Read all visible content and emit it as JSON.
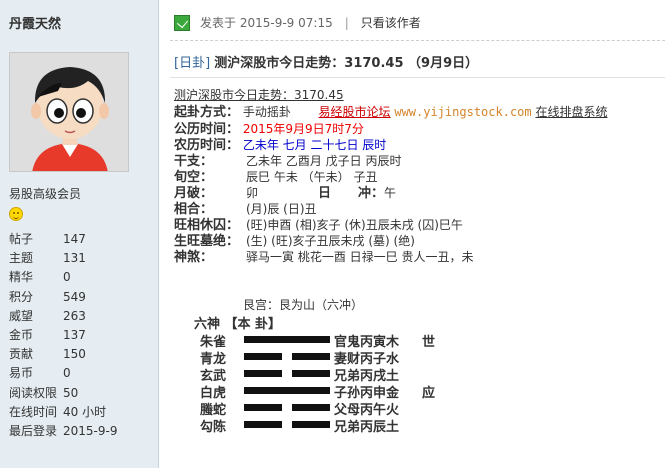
{
  "user": {
    "name": "丹霞天然",
    "group": "易股高级会员",
    "stats": [
      {
        "label": "帖子",
        "value": "147"
      },
      {
        "label": "主题",
        "value": "131"
      },
      {
        "label": "精华",
        "value": "0"
      },
      {
        "label": "积分",
        "value": "549"
      },
      {
        "label": "威望",
        "value": "263"
      },
      {
        "label": "金币",
        "value": "137"
      },
      {
        "label": "贡献",
        "value": "150"
      },
      {
        "label": "易币",
        "value": "0"
      },
      {
        "label": "阅读权限",
        "value": "50"
      },
      {
        "label": "在线时间",
        "value": "40 小时"
      },
      {
        "label": "最后登录",
        "value": "2015-9-9"
      }
    ]
  },
  "post": {
    "posted_prefix": "发表于",
    "posted_time": "2015-9-9 07:15",
    "separator": "|",
    "author_only": "只看该作者",
    "tag": "[日卦]",
    "title": "测沪深股市今日走势：3170.45 （9月9日）"
  },
  "body": {
    "first_line": "测沪深股市今日走势：3170.45",
    "method_label": "起卦方式：",
    "method_value": "手动摇卦",
    "forum_name": "易经股市论坛",
    "site_url": "www.yijingstock.com",
    "online_text": "在线排盘系统",
    "gregorian_label": "公历时间：",
    "gregorian_value": "2015年9月9日7时7分",
    "lunar_label": "农历时间：",
    "lunar_value": "乙未年  七月  二十七日  辰时",
    "ganzhi_label": "干支：",
    "ganzhi_value": "乙未年 乙酉月 戊子日 丙辰时",
    "xunkong_label": "旬空：",
    "xunkong_value": "辰巳    午未    （午未）    子丑",
    "yuepo_label": "月破：",
    "yuepo_value": "卯",
    "ri_label": "日",
    "chong_label": "冲：",
    "chong_value": "午",
    "xianghe_label": "相合：",
    "xianghe_value": "(月)辰      (日)丑",
    "wangxiang_label": "旺相休囚：",
    "wangxiang_value": "(旺)申酉    (相)亥子    (休)丑辰未戌    (囚)巳午",
    "changsheng_label": "生旺墓绝：",
    "changsheng_value": "(生)     (旺)亥子丑辰未戌     (墓)      (绝)",
    "shensha_label": "神煞：",
    "shensha_value": "驿马一寅    桃花一酉    日禄一巳    贵人一丑，未"
  },
  "hexagram": {
    "palace": "艮宫：艮为山（六冲）",
    "header": "六神 【本    卦】",
    "lines": [
      {
        "spirit": "朱雀",
        "yin": false,
        "relation": "官鬼丙寅木",
        "mark": "世"
      },
      {
        "spirit": "青龙",
        "yin": true,
        "relation": "妻财丙子水",
        "mark": ""
      },
      {
        "spirit": "玄武",
        "yin": true,
        "relation": "兄弟丙戌土",
        "mark": ""
      },
      {
        "spirit": "白虎",
        "yin": false,
        "relation": "子孙丙申金",
        "mark": "应"
      },
      {
        "spirit": "螣蛇",
        "yin": true,
        "relation": "父母丙午火",
        "mark": ""
      },
      {
        "spirit": "勾陈",
        "yin": true,
        "relation": "兄弟丙辰土",
        "mark": ""
      }
    ]
  },
  "icons": {
    "online": "online-status-icon",
    "rank": "smiley-rank-icon",
    "avatar": "cartoon-avatar-icon"
  },
  "colors": {
    "sidebar_bg": "#e5edf2",
    "red_text": "#e00000",
    "blue_text": "#0000cc",
    "link_orange": "#d4842b"
  }
}
